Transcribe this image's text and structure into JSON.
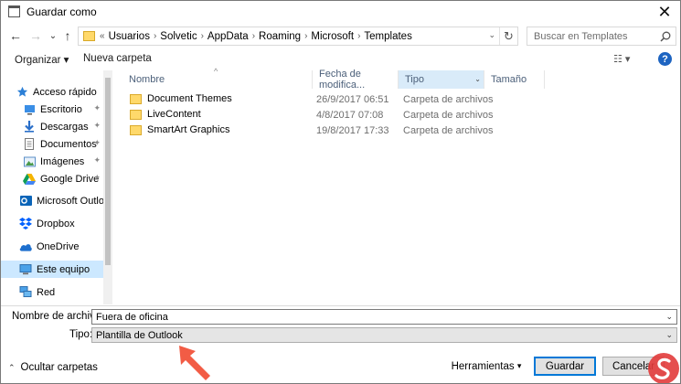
{
  "window": {
    "title": "Guardar como",
    "close_glyph": "✕"
  },
  "nav": {
    "back_glyph": "←",
    "forward_glyph": "→",
    "recent_glyph": "⌄",
    "up_glyph": "↑",
    "address_overflow": "«",
    "breadcrumb": [
      "Usuarios",
      "Solvetic",
      "AppData",
      "Roaming",
      "Microsoft",
      "Templates"
    ],
    "separator": "›",
    "address_dropdown_glyph": "⌄",
    "refresh_glyph": "↻",
    "search_placeholder": "Buscar en Templates"
  },
  "commands": {
    "organize": "Organizar ▾",
    "new_folder": "Nueva carpeta",
    "view_glyph": "☷ ▾",
    "help_glyph": "?"
  },
  "navpane": {
    "items": [
      {
        "label": "Acceso rápido",
        "icon": "star-icon",
        "pinned": false,
        "selected": false
      },
      {
        "label": "Escritorio",
        "icon": "desktop-icon",
        "pinned": true,
        "selected": false
      },
      {
        "label": "Descargas",
        "icon": "download-icon",
        "pinned": true,
        "selected": false
      },
      {
        "label": "Documentos",
        "icon": "documents-icon",
        "pinned": true,
        "selected": false
      },
      {
        "label": "Imágenes",
        "icon": "pictures-icon",
        "pinned": true,
        "selected": false
      },
      {
        "label": "Google Drive",
        "icon": "google-drive-icon",
        "pinned": true,
        "selected": false
      },
      {
        "label": "Microsoft Outlook",
        "icon": "outlook-icon",
        "pinned": false,
        "selected": false
      },
      {
        "label": "Dropbox",
        "icon": "dropbox-icon",
        "pinned": false,
        "selected": false
      },
      {
        "label": "OneDrive",
        "icon": "onedrive-icon",
        "pinned": false,
        "selected": false
      },
      {
        "label": "Este equipo",
        "icon": "computer-icon",
        "pinned": false,
        "selected": true
      },
      {
        "label": "Red",
        "icon": "network-icon",
        "pinned": false,
        "selected": false
      }
    ],
    "pin_glyph": "📌"
  },
  "filelist": {
    "columns": [
      {
        "label": "Nombre",
        "sorted": false
      },
      {
        "label": "Fecha de modifica...",
        "sorted": false
      },
      {
        "label": "Tipo",
        "sorted": true
      },
      {
        "label": "Tamaño",
        "sorted": false
      }
    ],
    "sort_glyph": "^",
    "dropdown_glyph": "⌄",
    "rows": [
      {
        "name": "Document Themes",
        "date": "26/9/2017 06:51",
        "type": "Carpeta de archivos"
      },
      {
        "name": "LiveContent",
        "date": "4/8/2017 07:08",
        "type": "Carpeta de archivos"
      },
      {
        "name": "SmartArt Graphics",
        "date": "19/8/2017 17:33",
        "type": "Carpeta de archivos"
      }
    ]
  },
  "form": {
    "filename_label": "Nombre de archivo:",
    "filename_value": "Fuera de oficina",
    "type_label": "Tipo:",
    "type_value": "Plantilla de Outlook",
    "dropdown_glyph": "⌄"
  },
  "footer": {
    "hide_folders": "Ocultar carpetas",
    "caret_glyph": "⌃",
    "tools": "Herramientas",
    "tools_caret": "▾",
    "save": "Guardar",
    "cancel": "Cancelar"
  },
  "colors": {
    "selection": "#cce8ff",
    "accent": "#0078d7",
    "annotation_arrow": "#f25c45",
    "folder": "#ffd96b"
  }
}
